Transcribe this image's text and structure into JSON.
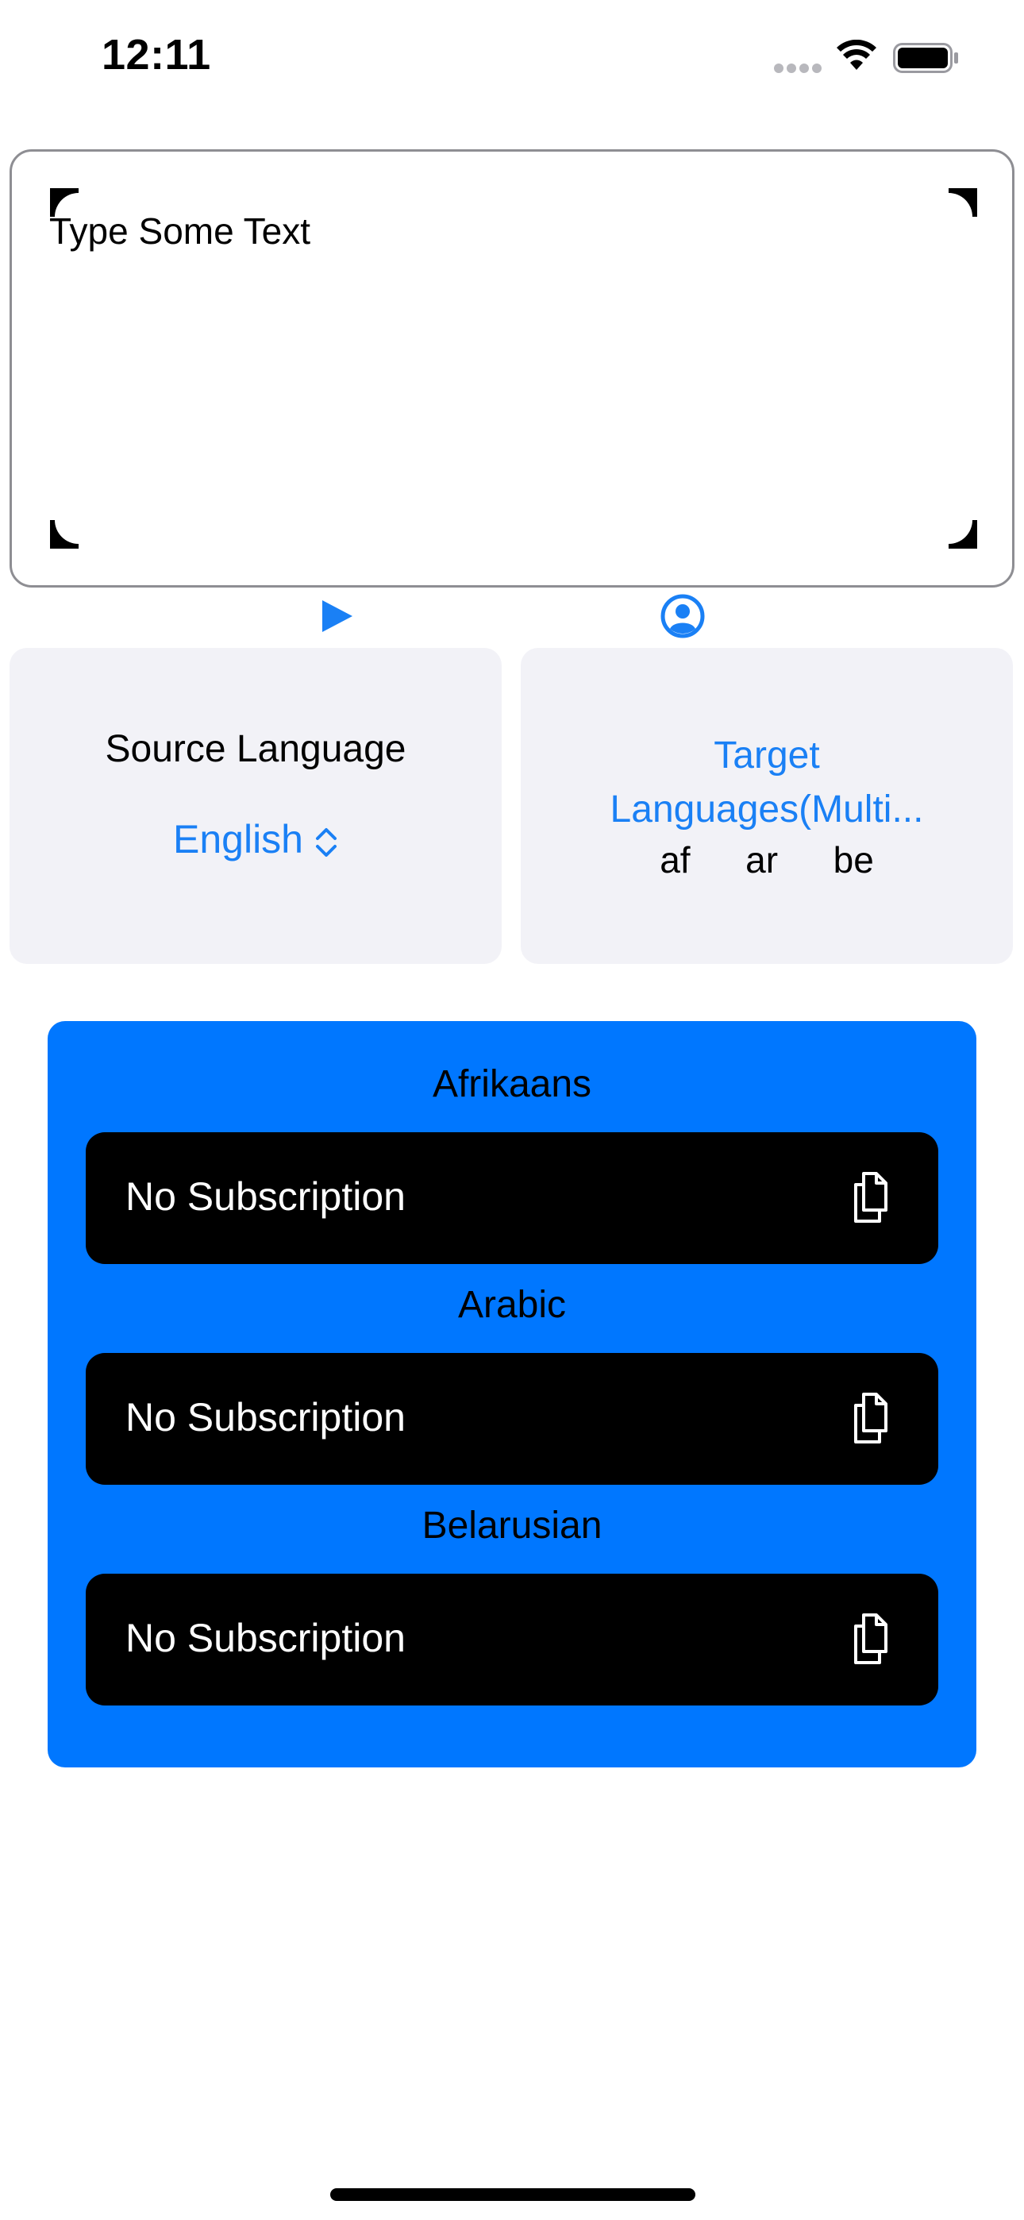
{
  "status_bar": {
    "time": "12:11"
  },
  "input": {
    "placeholder": "Type Some Text"
  },
  "icons": {
    "play": "play-icon",
    "profile": "person-circle-icon",
    "copy": "doc-on-doc-icon",
    "picker": "chevron-up-down-icon"
  },
  "source_language": {
    "title": "Source Language",
    "selected": "English"
  },
  "target_languages": {
    "title_line1": "Target",
    "title_line2": "Languages(Multi...",
    "codes": "af  ar  be"
  },
  "results": [
    {
      "language": "Afrikaans",
      "text": "No Subscription"
    },
    {
      "language": "Arabic",
      "text": "No Subscription"
    },
    {
      "language": "Belarusian",
      "text": "No Subscription"
    }
  ],
  "colors": {
    "accent": "#1a80f5",
    "panel": "#0077ff",
    "card_background": "#f2f2f7",
    "row_background": "#000000"
  }
}
